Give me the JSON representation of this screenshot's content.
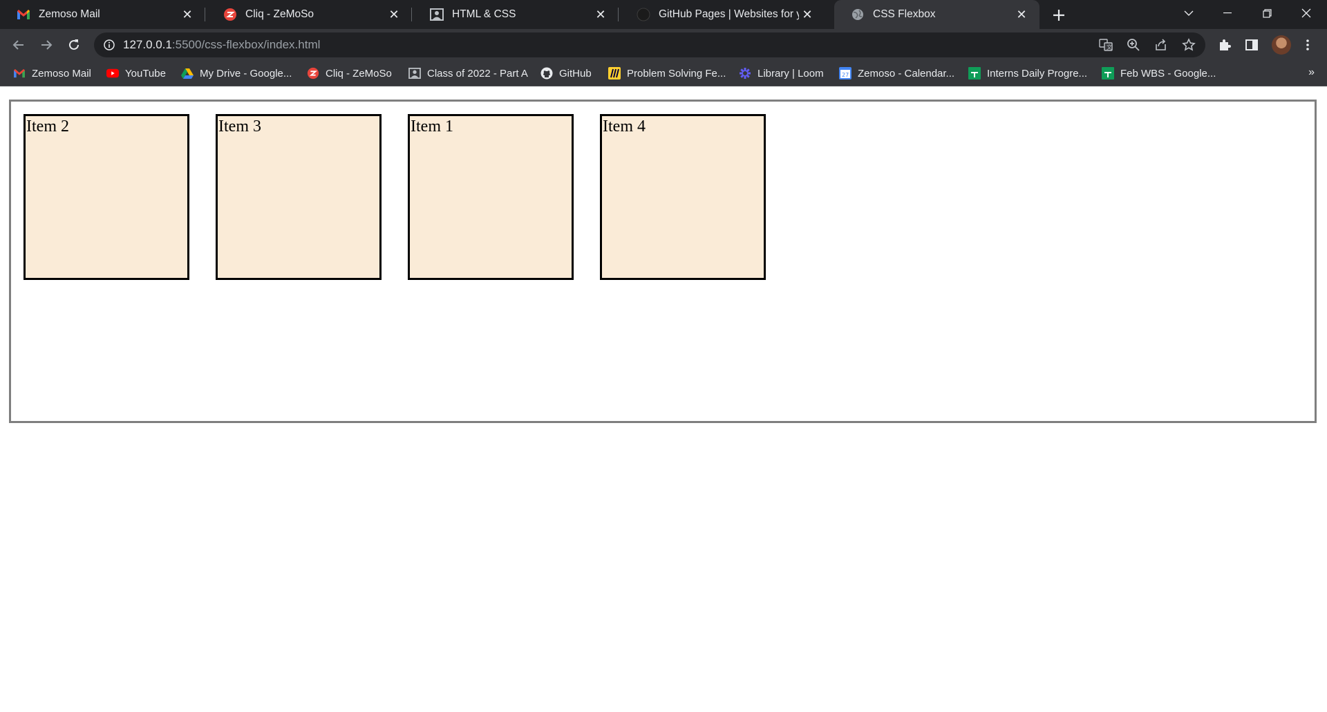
{
  "browser": {
    "tabs": [
      {
        "title": "Zemoso Mail",
        "icon": "gmail-icon",
        "active": false
      },
      {
        "title": "Cliq - ZeMoSo",
        "icon": "cliq-icon",
        "active": false
      },
      {
        "title": "HTML & CSS",
        "icon": "classroom-icon",
        "active": false
      },
      {
        "title": "GitHub Pages | Websites for you",
        "icon": "github-icon",
        "active": false
      },
      {
        "title": "CSS Flexbox",
        "icon": "globe-icon",
        "active": true
      }
    ],
    "address": {
      "host": "127.0.0.1",
      "path": ":5500/css-flexbox/index.html"
    },
    "bookmarks": [
      {
        "label": "Zemoso Mail",
        "icon": "gmail-icon"
      },
      {
        "label": "YouTube",
        "icon": "youtube-icon"
      },
      {
        "label": "My Drive - Google...",
        "icon": "drive-icon"
      },
      {
        "label": "Cliq - ZeMoSo",
        "icon": "cliq-icon"
      },
      {
        "label": "Class of 2022 - Part A",
        "icon": "classroom-icon"
      },
      {
        "label": "GitHub",
        "icon": "github-icon"
      },
      {
        "label": "Problem Solving Fe...",
        "icon": "miro-icon"
      },
      {
        "label": "Library | Loom",
        "icon": "loom-icon"
      },
      {
        "label": "Zemoso - Calendar...",
        "icon": "calendar-icon"
      },
      {
        "label": "Interns Daily Progre...",
        "icon": "sheets-icon"
      },
      {
        "label": "Feb WBS - Google...",
        "icon": "sheets-icon"
      }
    ],
    "bookmarks_overflow": "»"
  },
  "page": {
    "items": [
      "Item 2",
      "Item 3",
      "Item 1",
      "Item 4"
    ]
  },
  "colors": {
    "item_background": "#faebd7",
    "item_border": "#000000",
    "container_border": "#7f7f7f",
    "tabstrip": "#202124",
    "toolbar": "#35363a"
  }
}
